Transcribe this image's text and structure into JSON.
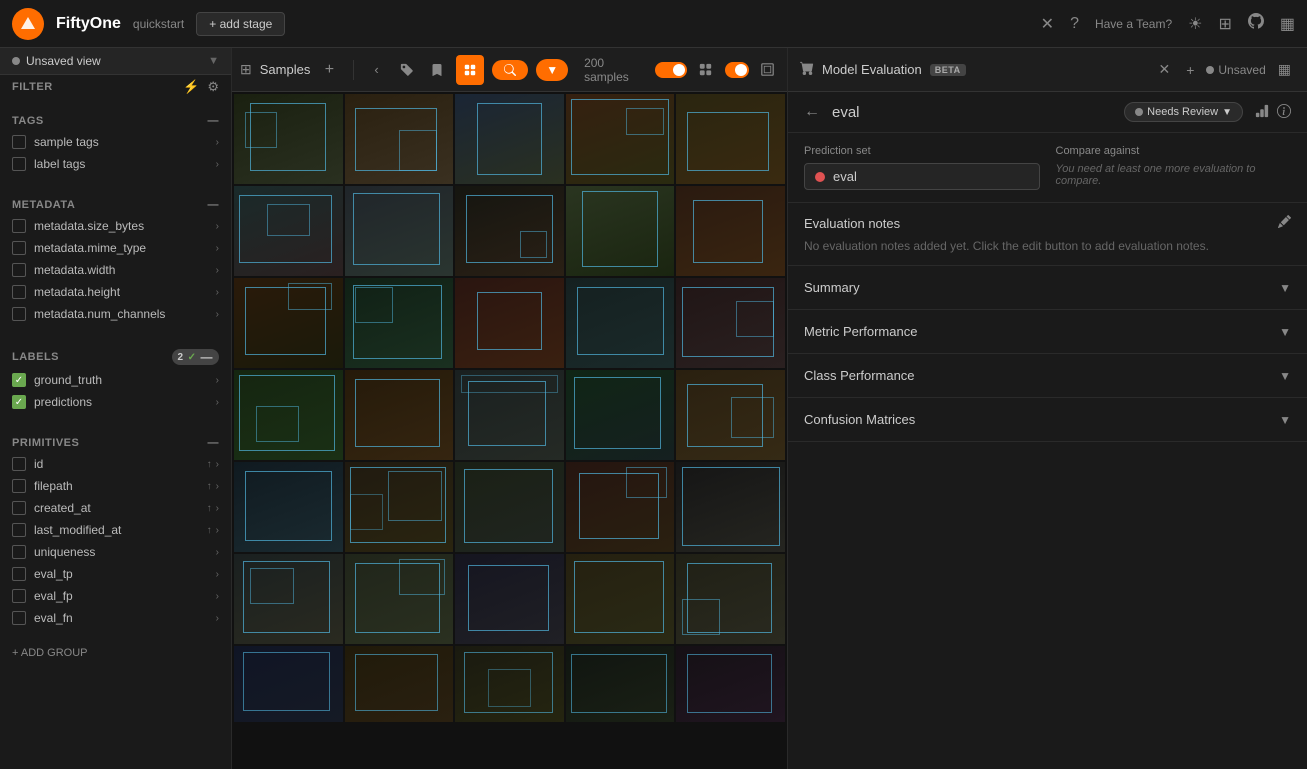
{
  "app": {
    "name": "FiftyOne",
    "workspace": "quickstart"
  },
  "topbar": {
    "add_stage": "+ add stage",
    "team_link": "Have a Team?",
    "close_icon": "✕",
    "help_icon": "?",
    "sun_icon": "☀",
    "grid_icon": "⊞",
    "github_icon": "⌥",
    "sidebar_icon": "▦"
  },
  "sidebar": {
    "view_label": "Unsaved view",
    "filter_label": "FILTER",
    "sections": {
      "tags": {
        "label": "TAGS",
        "items": [
          {
            "label": "sample tags",
            "checked": false
          },
          {
            "label": "label tags",
            "checked": false
          }
        ]
      },
      "metadata": {
        "label": "METADATA",
        "items": [
          {
            "label": "metadata.size_bytes",
            "checked": false
          },
          {
            "label": "metadata.mime_type",
            "checked": false
          },
          {
            "label": "metadata.width",
            "checked": false
          },
          {
            "label": "metadata.height",
            "checked": false
          },
          {
            "label": "metadata.num_channels",
            "checked": false
          }
        ]
      },
      "labels": {
        "label": "LABELS",
        "count": "2",
        "items": [
          {
            "label": "ground_truth",
            "checked": true
          },
          {
            "label": "predictions",
            "checked": true
          }
        ]
      },
      "primitives": {
        "label": "PRIMITIVES",
        "items": [
          {
            "label": "id",
            "checked": false
          },
          {
            "label": "filepath",
            "checked": false
          },
          {
            "label": "created_at",
            "checked": false
          },
          {
            "label": "last_modified_at",
            "checked": false
          },
          {
            "label": "uniqueness",
            "checked": false
          },
          {
            "label": "eval_tp",
            "checked": false
          },
          {
            "label": "eval_fp",
            "checked": false
          },
          {
            "label": "eval_fn",
            "checked": false
          }
        ]
      }
    },
    "add_group": "+ ADD GROUP"
  },
  "samples_panel": {
    "label": "Samples",
    "count": "200 samples",
    "add_icon": "+",
    "grid_icon": "⊞",
    "list_icon": "≡",
    "view_icon": "⊟",
    "toggle_icon": "◐"
  },
  "eval_panel": {
    "title": "Model Evaluation",
    "beta_label": "BETA",
    "eval_name": "eval",
    "status": {
      "label": "Needs Review",
      "dot_color": "#888"
    },
    "prediction_set": {
      "label": "Prediction set",
      "value": "eval",
      "dot_color": "#e05252"
    },
    "compare_against": {
      "label": "Compare against",
      "note": "You need at least one more evaluation to compare."
    },
    "evaluation_notes": {
      "title": "Evaluation notes",
      "content": "No evaluation notes added yet. Click the edit button to add evaluation notes."
    },
    "sections": [
      {
        "id": "summary",
        "label": "Summary"
      },
      {
        "id": "metric-performance",
        "label": "Metric Performance"
      },
      {
        "id": "class-performance",
        "label": "Class Performance"
      },
      {
        "id": "confusion-matrices",
        "label": "Confusion Matrices"
      }
    ],
    "unsaved_label": "Unsaved"
  }
}
